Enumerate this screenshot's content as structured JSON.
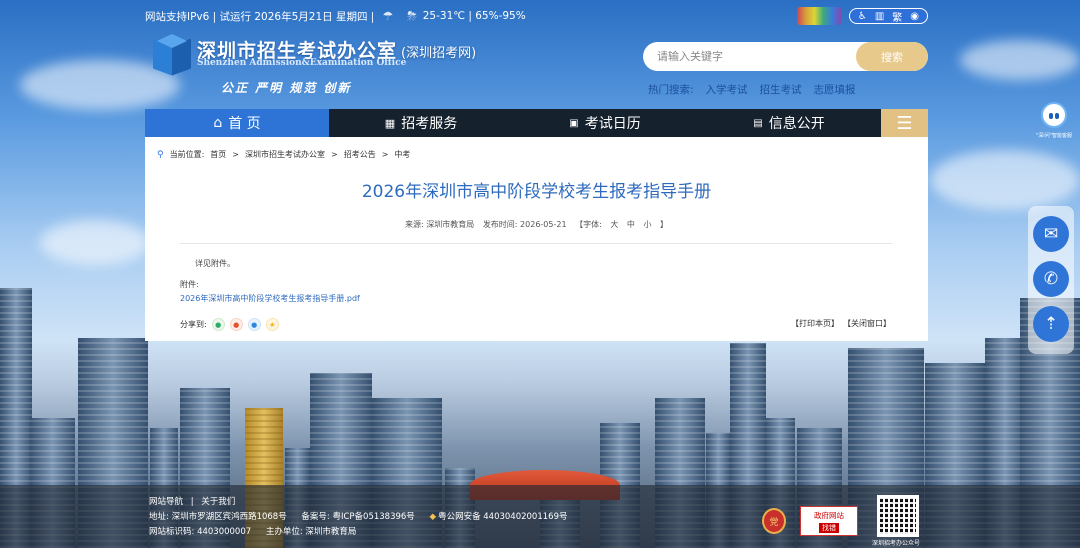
{
  "topbar": {
    "info_text": "网站支持IPv6 | 试运行   2026年5月21日 星期四 |",
    "weather_text": "25-31℃ | 65%-95%",
    "access_icons": [
      "accessibility-icon",
      "elder-mode-icon",
      "traditional-chinese-icon",
      "speaker-icon"
    ],
    "traditional_label": "繁"
  },
  "header": {
    "site_title": "深圳市招生考试办公室",
    "site_subtitle": "(深圳招考网)",
    "site_title_en": "Shenzhen Admission&Examination Office",
    "slogan": "公正  严明  规范  创新"
  },
  "search": {
    "placeholder": "请输入关键字",
    "button_label": "搜索"
  },
  "hot_search": {
    "label": "热门搜索:",
    "items": [
      "入学考试",
      "招生考试",
      "志愿填报"
    ]
  },
  "nav": {
    "items": [
      {
        "label": "首 页",
        "icon": "home-icon"
      },
      {
        "label": "招考服务",
        "icon": "grid-icon"
      },
      {
        "label": "考试日历",
        "icon": "calendar-icon"
      },
      {
        "label": "信息公开",
        "icon": "document-icon"
      }
    ],
    "menu_icon": "hamburger-menu-icon"
  },
  "breadcrumb": {
    "label": "当前位置:",
    "items": [
      "首页",
      "深圳市招生考试办公室",
      "招考公告",
      "中考"
    ],
    "separator": ">"
  },
  "article": {
    "title": "2026年深圳市高中阶段学校考生报考指导手册",
    "source": "来源:  深圳市教育局",
    "publish_time": "发布时间:  2026-05-21",
    "font_size_label": "【字体:",
    "font_sizes": [
      "大",
      "中",
      "小"
    ],
    "font_size_close": "】",
    "body": "详见附件。",
    "attachment_label": "附件:",
    "attachment_link": "2026年深圳市高中阶段学校考生报考指导手册.pdf",
    "share_label": "分享到:",
    "share_icons": [
      "wechat-icon",
      "weibo-icon",
      "qq-icon",
      "qzone-icon"
    ],
    "print_label": "【打印本页】",
    "close_label": "【关闭窗口】"
  },
  "side": {
    "robot_caption": "\"深i问\"智能客服",
    "buttons": [
      "wechat-icon",
      "phone-icon",
      "back-to-top-icon"
    ]
  },
  "footer": {
    "nav_links": [
      "网站导航",
      "关于我们"
    ],
    "nav_sep": "|",
    "address": "地址:  深圳市罗湖区宾鸿西路1068号",
    "icp": "备案号:  粤ICP备05138396号",
    "police": "粤公网安备 44030402001169号",
    "site_code": "网站标识码:  4403000007",
    "sponsor": "主办单位:  深圳市教育局",
    "badge_gov": "政府网站",
    "badge_error_top": "政府网站",
    "badge_error": "找错",
    "qr_caption": "深圳招考办公众号"
  },
  "colors": {
    "nav_active": "#2d74d6",
    "nav_bg": "#16212e",
    "menu_gold": "#e2c185",
    "search_button": "#e7c98c",
    "title_blue": "#2e6bbf"
  }
}
